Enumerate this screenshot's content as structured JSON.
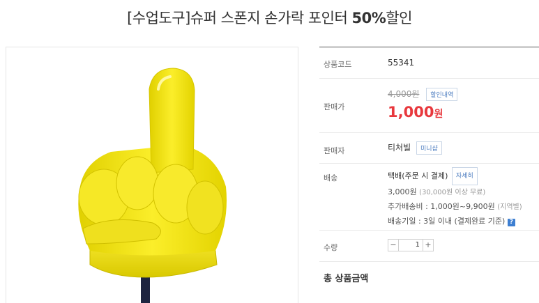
{
  "product": {
    "title_prefix": "[수업도구]슈퍼 스폰지 손가락 포인터 ",
    "title_bold": "50%",
    "title_suffix": "할인"
  },
  "info": {
    "code_label": "상품코드",
    "code_value": "55341",
    "price_label": "판매가",
    "original_price": "4,000원",
    "discount_button": "할인내역",
    "sale_price": "1,000",
    "sale_unit": "원",
    "seller_label": "판매자",
    "seller_value": "티처빌",
    "minishop_button": "미니샵",
    "shipping_label": "배송",
    "shipping_method": "택배(주문 시 결제)",
    "detail_button": "자세히",
    "shipping_fee": "3,000원",
    "free_condition": "(30,000원 이상 무료)",
    "extra_fee": "추가배송비 : 1,000원~9,900원",
    "extra_note": "(지역별)",
    "delivery_time": "배송기일 : 3일 이내 (결제완료 기준)",
    "help_icon": "?",
    "qty_label": "수량",
    "qty_minus": "−",
    "qty_value": "1",
    "qty_plus": "+",
    "total_label": "총 상품금액"
  },
  "colors": {
    "price": "#e8383d",
    "link_button": "#4a7bbf",
    "hand": "#f3e41a"
  },
  "icons": {
    "hand_image": "yellow-foam-pointing-hand",
    "help": "question-icon"
  }
}
